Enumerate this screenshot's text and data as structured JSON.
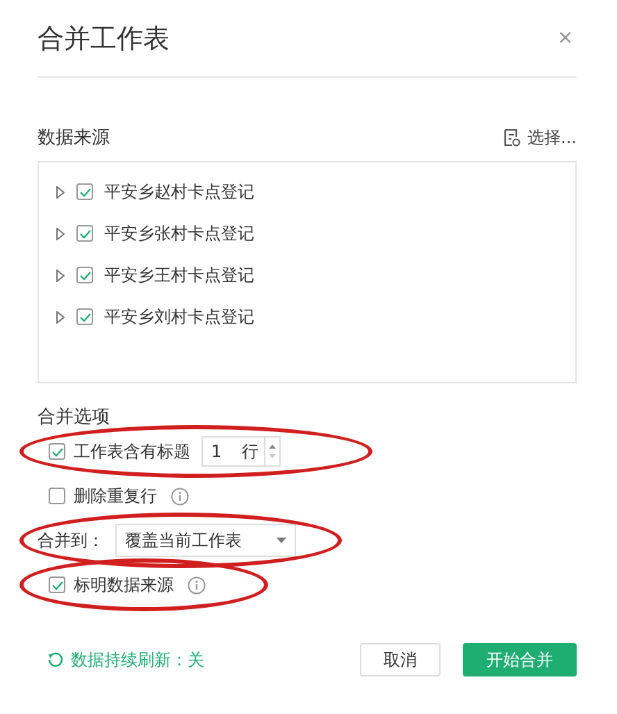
{
  "dialog": {
    "title": "合并工作表",
    "close": "×"
  },
  "source": {
    "label": "数据来源",
    "select_button": "选择..."
  },
  "sheets": [
    {
      "name": "平安乡赵村卡点登记",
      "checked": true,
      "expanded": false
    },
    {
      "name": "平安乡张村卡点登记",
      "checked": true,
      "expanded": false
    },
    {
      "name": "平安乡王村卡点登记",
      "checked": true,
      "expanded": false
    },
    {
      "name": "平安乡刘村卡点登记",
      "checked": true,
      "expanded": false
    }
  ],
  "options_label": "合并选项",
  "options": [
    {
      "kind": "checkbox_spin",
      "label": "工作表含有标题",
      "checked": true,
      "value": "1",
      "unit": "行",
      "highlighted": true
    },
    {
      "kind": "checkbox",
      "label": "删除重复行",
      "checked": false,
      "info": true,
      "highlighted": false
    },
    {
      "kind": "select",
      "label": "合并到：",
      "value": "覆盖当前工作表",
      "highlighted": true
    },
    {
      "kind": "checkbox",
      "label": "标明数据来源",
      "checked": true,
      "info": true,
      "highlighted": true
    }
  ],
  "footer": {
    "refresh": "数据持续刷新：关",
    "buttons": [
      {
        "label": "取消",
        "primary": false
      },
      {
        "label": "开始合并",
        "primary": true
      }
    ]
  }
}
